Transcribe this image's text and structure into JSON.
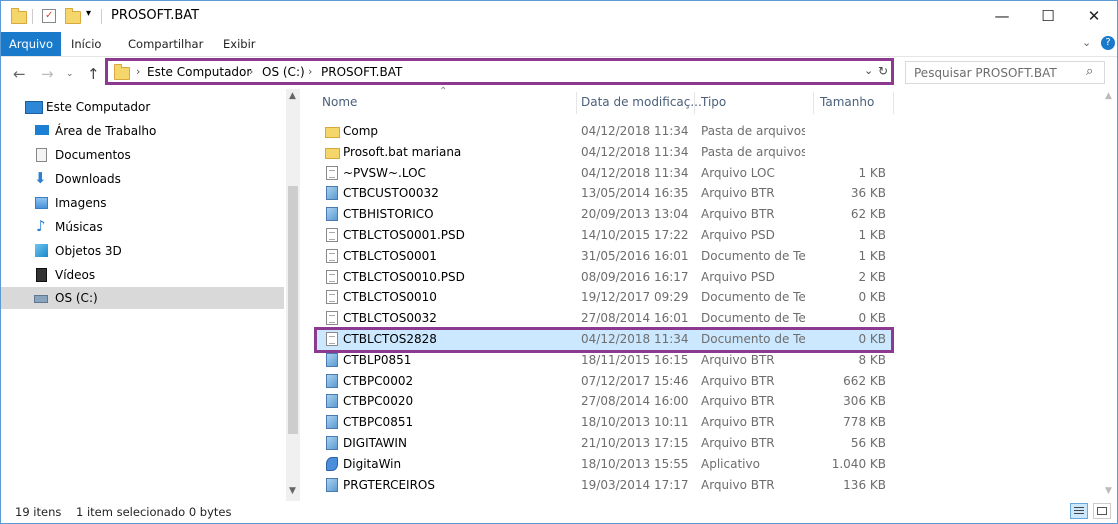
{
  "window": {
    "title": "PROSOFT.BAT"
  },
  "ribbon": {
    "tabs": [
      "Arquivo",
      "Início",
      "Compartilhar",
      "Exibir"
    ]
  },
  "address": {
    "crumbs": [
      "Este Computador",
      "OS (C:)",
      "PROSOFT.BAT"
    ]
  },
  "search": {
    "placeholder": "Pesquisar PROSOFT.BAT"
  },
  "nav": {
    "items": [
      {
        "label": "Este Computador",
        "icon": "computer-icon"
      },
      {
        "label": "Área de Trabalho",
        "icon": "desktop-icon"
      },
      {
        "label": "Documentos",
        "icon": "documents-icon"
      },
      {
        "label": "Downloads",
        "icon": "download-icon"
      },
      {
        "label": "Imagens",
        "icon": "pictures-icon"
      },
      {
        "label": "Músicas",
        "icon": "music-icon"
      },
      {
        "label": "Objetos 3D",
        "icon": "3d-objects-icon"
      },
      {
        "label": "Vídeos",
        "icon": "videos-icon"
      },
      {
        "label": "OS (C:)",
        "icon": "drive-icon"
      }
    ]
  },
  "columns": {
    "name": "Nome",
    "date": "Data de modificaç...",
    "type": "Tipo",
    "size": "Tamanho"
  },
  "files": [
    {
      "name": "Comp",
      "date": "04/12/2018 11:34",
      "type": "Pasta de arquivos",
      "size": "",
      "icon": "folder-icon"
    },
    {
      "name": "Prosoft.bat  mariana",
      "date": "04/12/2018 11:34",
      "type": "Pasta de arquivos",
      "size": "",
      "icon": "folder-icon"
    },
    {
      "name": "~PVSW~.LOC",
      "date": "04/12/2018 11:34",
      "type": "Arquivo LOC",
      "size": "1 KB",
      "icon": "file-icon"
    },
    {
      "name": "CTBCUSTO0032",
      "date": "13/05/2014 16:35",
      "type": "Arquivo BTR",
      "size": "36 KB",
      "icon": "btr-file-icon"
    },
    {
      "name": "CTBHISTORICO",
      "date": "20/09/2013 13:04",
      "type": "Arquivo BTR",
      "size": "62 KB",
      "icon": "btr-file-icon"
    },
    {
      "name": "CTBLCTOS0001.PSD",
      "date": "14/10/2015 17:22",
      "type": "Arquivo PSD",
      "size": "1 KB",
      "icon": "file-icon"
    },
    {
      "name": "CTBLCTOS0001",
      "date": "31/05/2016 16:01",
      "type": "Documento de Te...",
      "size": "1 KB",
      "icon": "text-file-icon"
    },
    {
      "name": "CTBLCTOS0010.PSD",
      "date": "08/09/2016 16:17",
      "type": "Arquivo PSD",
      "size": "2 KB",
      "icon": "file-icon"
    },
    {
      "name": "CTBLCTOS0010",
      "date": "19/12/2017 09:29",
      "type": "Documento de Te...",
      "size": "0 KB",
      "icon": "text-file-icon"
    },
    {
      "name": "CTBLCTOS0032",
      "date": "27/08/2014 16:01",
      "type": "Documento de Te...",
      "size": "0 KB",
      "icon": "text-file-icon"
    },
    {
      "name": "CTBLCTOS2828",
      "date": "04/12/2018 11:34",
      "type": "Documento de Te...",
      "size": "0 KB",
      "icon": "text-file-icon",
      "selected": true
    },
    {
      "name": "CTBLP0851",
      "date": "18/11/2015 16:15",
      "type": "Arquivo BTR",
      "size": "8 KB",
      "icon": "btr-file-icon"
    },
    {
      "name": "CTBPC0002",
      "date": "07/12/2017 15:46",
      "type": "Arquivo BTR",
      "size": "662 KB",
      "icon": "btr-file-icon"
    },
    {
      "name": "CTBPC0020",
      "date": "27/08/2014 16:00",
      "type": "Arquivo BTR",
      "size": "306 KB",
      "icon": "btr-file-icon"
    },
    {
      "name": "CTBPC0851",
      "date": "18/10/2013 10:11",
      "type": "Arquivo BTR",
      "size": "778 KB",
      "icon": "btr-file-icon"
    },
    {
      "name": "DIGITAWIN",
      "date": "21/10/2013 17:15",
      "type": "Arquivo BTR",
      "size": "56 KB",
      "icon": "btr-file-icon"
    },
    {
      "name": "DigitaWin",
      "date": "18/10/2013 15:55",
      "type": "Aplicativo",
      "size": "1.040 KB",
      "icon": "application-icon"
    },
    {
      "name": "PRGTERCEIROS",
      "date": "19/03/2014 17:17",
      "type": "Arquivo BTR",
      "size": "136 KB",
      "icon": "btr-file-icon"
    }
  ],
  "status": {
    "count": "19 itens",
    "selection": "1 item selecionado  0 bytes"
  }
}
